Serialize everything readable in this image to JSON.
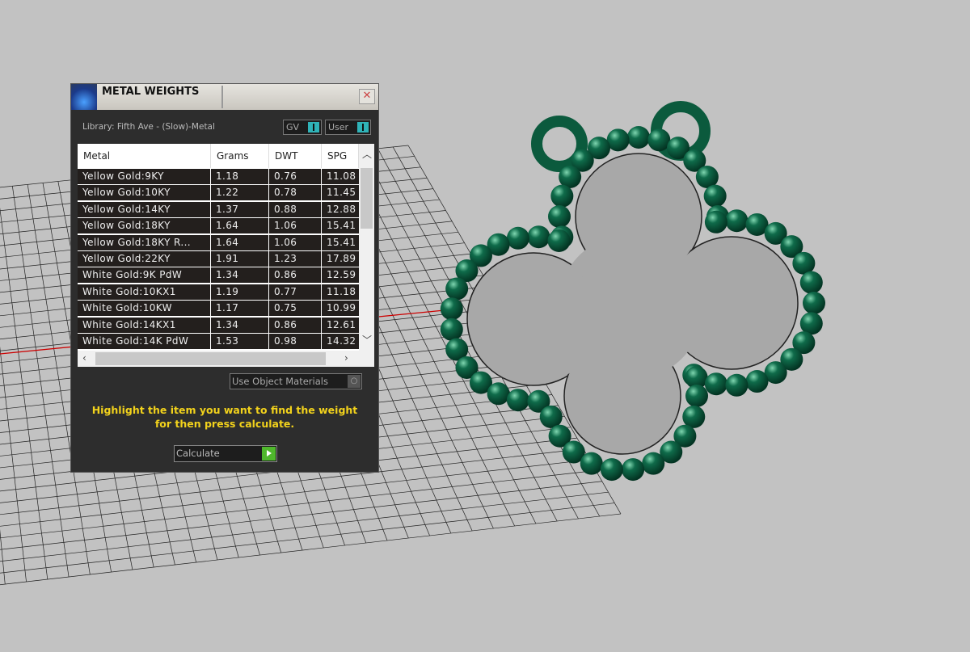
{
  "window": {
    "title": "METAL WEIGHTS",
    "close": "✕",
    "library": "Library: Fifth Ave - (Slow)-Metal",
    "toggles": [
      {
        "label": "GV"
      },
      {
        "label": "User"
      }
    ]
  },
  "table": {
    "headers": [
      "Metal",
      "Grams",
      "DWT",
      "SPG"
    ],
    "rows": [
      [
        "Yellow Gold:9KY",
        "1.18",
        "0.76",
        "11.08"
      ],
      [
        "Yellow Gold:10KY",
        "1.22",
        "0.78",
        "11.45"
      ],
      [
        "Yellow Gold:14KY",
        "1.37",
        "0.88",
        "12.88"
      ],
      [
        "Yellow Gold:18KY",
        "1.64",
        "1.06",
        "15.41"
      ],
      [
        "Yellow Gold:18KY R...",
        "1.64",
        "1.06",
        "15.41"
      ],
      [
        "Yellow Gold:22KY",
        "1.91",
        "1.23",
        "17.89"
      ],
      [
        "White Gold:9K PdW",
        "1.34",
        "0.86",
        "12.59"
      ],
      [
        "White Gold:10KX1",
        "1.19",
        "0.77",
        "11.18"
      ],
      [
        "White Gold:10KW",
        "1.17",
        "0.75",
        "10.99"
      ],
      [
        "White Gold:14KX1",
        "1.34",
        "0.86",
        "12.61"
      ],
      [
        "White Gold:14K PdW",
        "1.53",
        "0.98",
        "14.32"
      ]
    ]
  },
  "use_object_materials": "Use Object Materials",
  "message": [
    "Highlight the item you want to find the weight",
    "for then press calculate."
  ],
  "calculate": "Calculate",
  "colors": {
    "bead": "#0f6b4a",
    "accent": "#2fb3b8",
    "message": "#f2d21c"
  }
}
